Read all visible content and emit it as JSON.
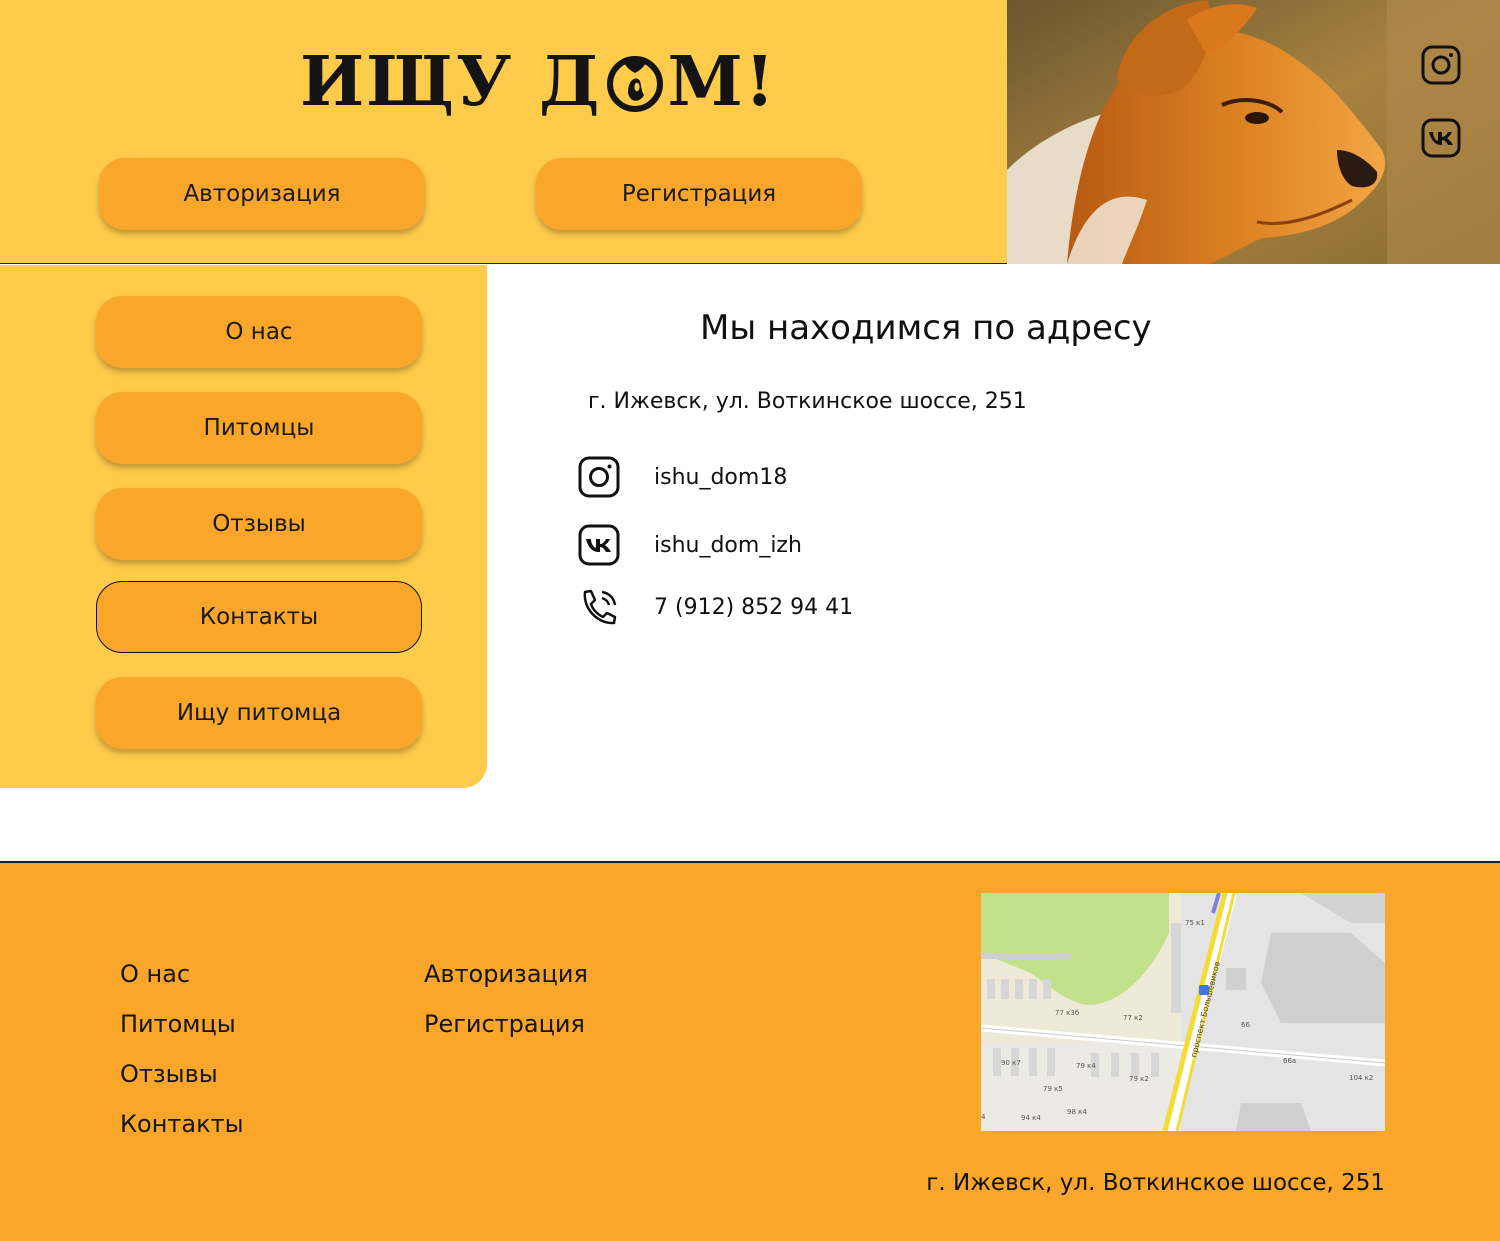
{
  "header": {
    "logo_text_left": "ИЩУ Д",
    "logo_text_right": "М!",
    "auth_button": "Авторизация",
    "register_button": "Регистрация",
    "social": [
      "instagram-icon",
      "vk-icon"
    ]
  },
  "sidebar": {
    "items": [
      {
        "label": "О нас",
        "active": false
      },
      {
        "label": "Питомцы",
        "active": false
      },
      {
        "label": "Отзывы",
        "active": false
      },
      {
        "label": "Контакты",
        "active": true
      },
      {
        "label": "Ищу питомца",
        "active": false
      }
    ]
  },
  "main": {
    "title": "Мы находимся по адресу",
    "address": "г. Ижевск, ул. Воткинское шоссе, 251",
    "contacts": [
      {
        "icon": "instagram-icon",
        "text": "ishu_dom18"
      },
      {
        "icon": "vk-icon",
        "text": "ishu_dom_izh"
      },
      {
        "icon": "phone-icon",
        "text": "7 (912) 852 94 41"
      }
    ]
  },
  "footer": {
    "col1": [
      "О нас",
      "Питомцы",
      "Отзывы",
      "Контакты"
    ],
    "col2": [
      "Авторизация",
      "Регистрация"
    ],
    "address": "г. Ижевск, ул. Воткинское шоссе, 251",
    "map": {
      "street": "проспект Большевиков",
      "labels": [
        "75 к1",
        "77 к3б",
        "77 к2",
        "66",
        "66а",
        "90 к7",
        "79 к4",
        "79 к2",
        "79 к5",
        "98 к4",
        "94 к4",
        "104 к2"
      ]
    }
  },
  "colors": {
    "header_bg": "#FFCB4A",
    "button_bg": "#F9A62B",
    "footer_bg": "#F9A62B"
  }
}
